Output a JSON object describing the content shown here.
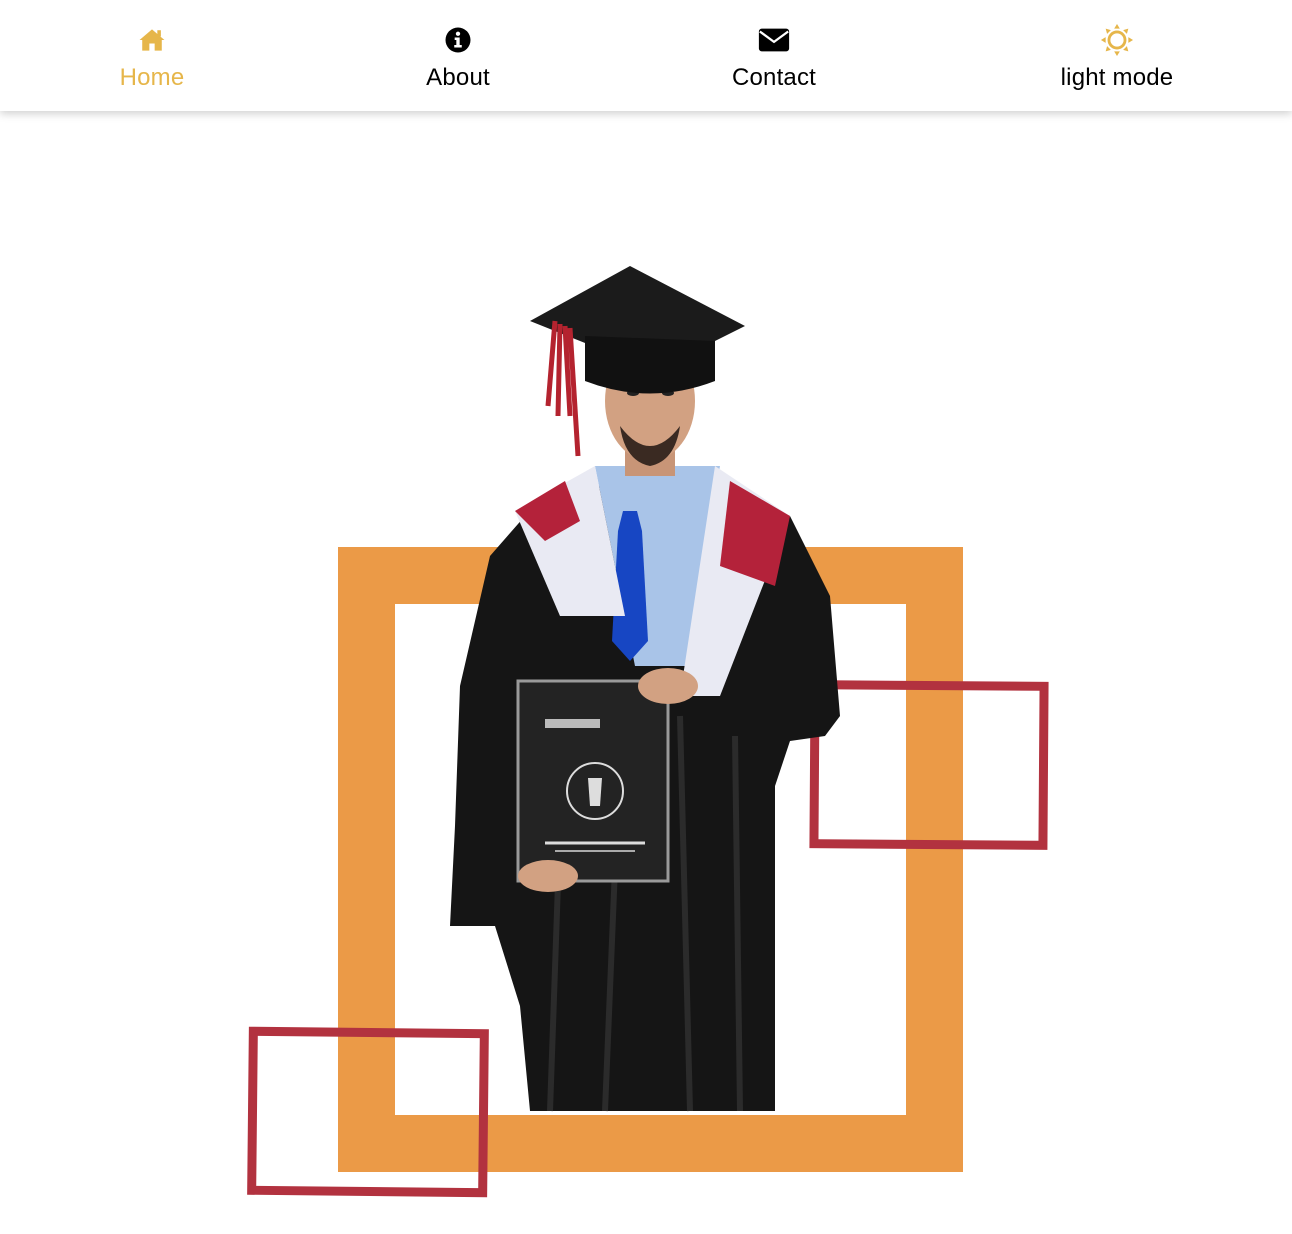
{
  "nav": {
    "items": [
      {
        "id": "home",
        "label": "Home",
        "icon": "home-icon",
        "active": true
      },
      {
        "id": "about",
        "label": "About",
        "icon": "info-circle-icon",
        "active": false
      },
      {
        "id": "contact",
        "label": "Contact",
        "icon": "envelope-icon",
        "active": false
      },
      {
        "id": "theme",
        "label": "light mode",
        "icon": "sun-icon",
        "active": false
      }
    ]
  },
  "colors": {
    "accent": "#e6b64a",
    "frame_orange": "#eb9a47",
    "frame_red": "#b2323f",
    "text": "#000000",
    "background": "#ffffff"
  },
  "hero": {
    "image": "graduate-portrait"
  }
}
